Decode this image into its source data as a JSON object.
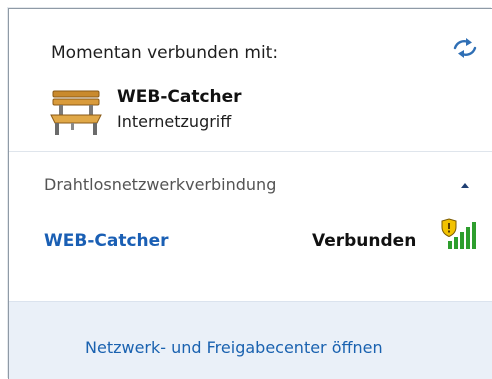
{
  "current_connection": {
    "heading": "Momentan verbunden mit:",
    "network_name": "WEB-Catcher",
    "access_type": "Internetzugriff",
    "network_icon": "bench-icon"
  },
  "wireless_section": {
    "title": "Drahtlosnetzwerkverbindung",
    "collapse_icon": "chevron-up-icon",
    "networks": [
      {
        "name": "WEB-Catcher",
        "status": "Verbunden",
        "signal_icon": "signal-strength-shield-icon"
      }
    ]
  },
  "footer": {
    "link_label": "Netzwerk- und Freigabecenter öffnen"
  },
  "colors": {
    "link_blue": "#1a62b0",
    "footer_background": "#eaf0f8",
    "signal_green": "#2e9e2e",
    "shield_yellow": "#f2c200"
  }
}
